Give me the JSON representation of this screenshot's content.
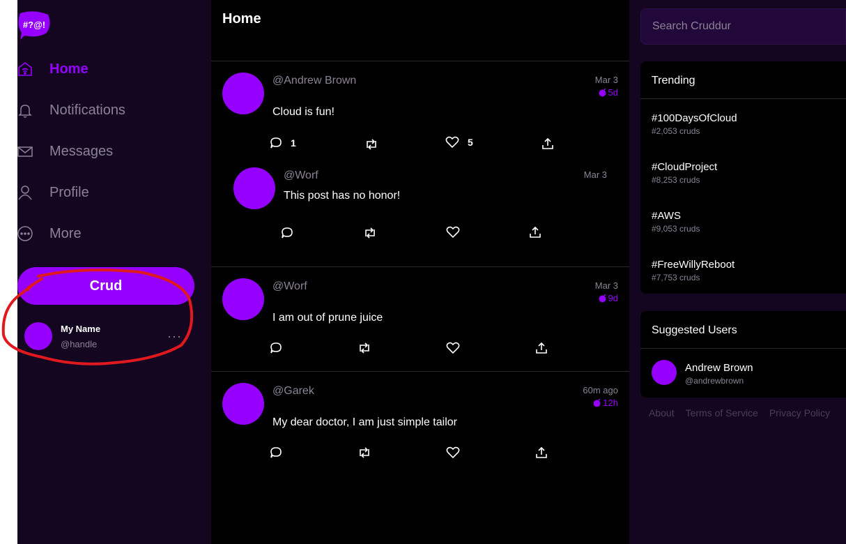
{
  "app": {
    "logo_text": "#?@!"
  },
  "sidebar": {
    "items": [
      {
        "label": "Home",
        "icon": "home-icon",
        "active": true
      },
      {
        "label": "Notifications",
        "icon": "bell-icon",
        "active": false
      },
      {
        "label": "Messages",
        "icon": "mail-icon",
        "active": false
      },
      {
        "label": "Profile",
        "icon": "person-icon",
        "active": false
      },
      {
        "label": "More",
        "icon": "more-circle-icon",
        "active": false
      }
    ],
    "crud_button": "Crud",
    "profile": {
      "name": "My Name",
      "handle": "@handle",
      "more": "···"
    }
  },
  "feed": {
    "title": "Home",
    "posts": [
      {
        "handle": "@Andrew Brown",
        "message": "Cloud is fun!",
        "time": "Mar 3",
        "expires": "5d",
        "replies": "1",
        "likes": "5"
      },
      {
        "handle": "@Worf",
        "message": "This post has no honor!",
        "time": "Mar 3",
        "expires": "",
        "replies": "",
        "likes": ""
      },
      {
        "handle": "@Worf",
        "message": "I am out of prune juice",
        "time": "Mar 3",
        "expires": "9d",
        "replies": "",
        "likes": ""
      },
      {
        "handle": "@Garek",
        "message": "My dear doctor, I am just simple tailor",
        "time": "60m ago",
        "expires": "12h",
        "replies": "",
        "likes": ""
      }
    ]
  },
  "right": {
    "search_placeholder": "Search Cruddur",
    "trending": {
      "title": "Trending",
      "items": [
        {
          "tag": "#100DaysOfCloud",
          "count": "#2,053 cruds"
        },
        {
          "tag": "#CloudProject",
          "count": "#8,253 cruds"
        },
        {
          "tag": "#AWS",
          "count": "#9,053 cruds"
        },
        {
          "tag": "#FreeWillyReboot",
          "count": "#7,753 cruds"
        }
      ]
    },
    "suggested": {
      "title": "Suggested Users",
      "users": [
        {
          "name": "Andrew Brown",
          "handle": "@andrewbrown"
        }
      ]
    },
    "footer": [
      "About",
      "Terms of Service",
      "Privacy Policy"
    ]
  },
  "colors": {
    "accent": "#9500ff",
    "sidebar_bg": "#140521",
    "feed_bg": "#000000",
    "muted_text": "#8b8394",
    "annotation": "#e0191e"
  }
}
